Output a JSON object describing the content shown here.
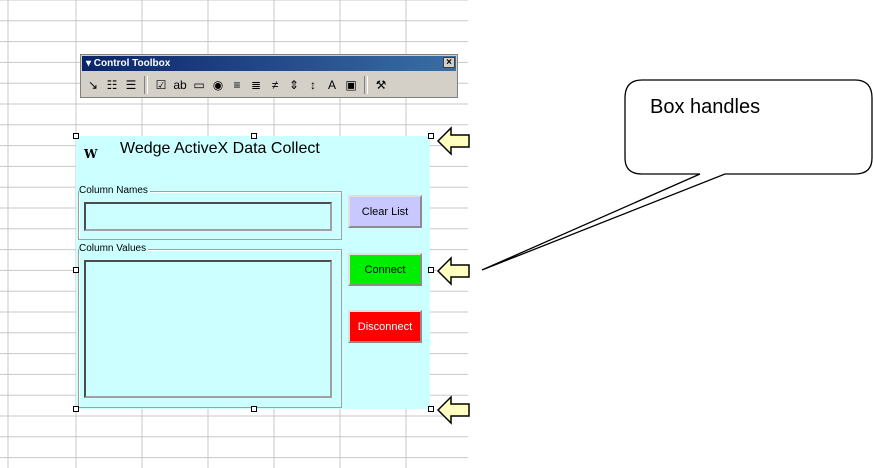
{
  "toolbox": {
    "title": "▾ Control Toolbox",
    "close_glyph": "×",
    "icons": [
      "design-mode-icon",
      "properties-icon",
      "view-code-icon",
      "checkbox-icon",
      "textbox-icon",
      "command-button-icon",
      "option-button-icon",
      "listbox-icon",
      "combobox-icon",
      "toggle-button-icon",
      "spin-button-icon",
      "scrollbar-icon",
      "label-icon",
      "image-icon",
      "more-controls-icon"
    ],
    "glyphs": [
      "↘",
      "☷",
      "☰",
      "☑",
      "ab",
      "▭",
      "◉",
      "≡",
      "≣",
      "≠",
      "⇕",
      "↕",
      "A",
      "▣",
      "⚒"
    ]
  },
  "form": {
    "title": "Wedge ActiveX Data Collect",
    "logo_glyph": "W",
    "column_names_label": "Column Names",
    "column_values_label": "Column Values",
    "clear_label": "Clear List",
    "connect_label": "Connect",
    "disconnect_label": "Disconnect"
  },
  "colors": {
    "form_bg": "#ccffff",
    "clear_bg": "#c8c8ff",
    "connect_bg": "#00ee00",
    "disconnect_bg": "#ff0000",
    "arrow_fill": "#ffffc0"
  },
  "callout": {
    "text": "Box handles"
  }
}
